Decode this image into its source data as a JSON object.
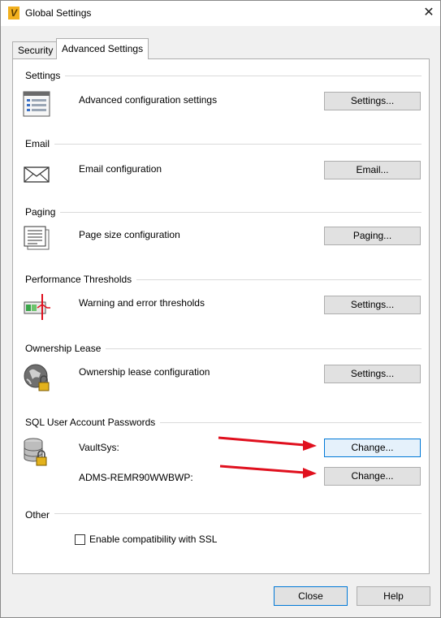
{
  "window": {
    "title": "Global Settings",
    "close_glyph": "✕",
    "app_icon": "vault-logo-icon",
    "app_icon_letter": "V"
  },
  "tabs": [
    {
      "label": "Security",
      "active": false
    },
    {
      "label": "Advanced Settings",
      "active": true
    }
  ],
  "sections": {
    "settings": {
      "title": "Settings",
      "description": "Advanced configuration settings",
      "button": "Settings...",
      "icon": "settings-list-icon"
    },
    "email": {
      "title": "Email",
      "description": "Email configuration",
      "button": "Email...",
      "icon": "envelope-icon"
    },
    "paging": {
      "title": "Paging",
      "description": "Page size configuration",
      "button": "Paging...",
      "icon": "document-pages-icon"
    },
    "performance": {
      "title": "Performance Thresholds",
      "description": "Warning and error thresholds",
      "button": "Settings...",
      "icon": "threshold-meter-icon"
    },
    "ownership": {
      "title": "Ownership Lease",
      "description": "Ownership lease configuration",
      "button": "Settings...",
      "icon": "globe-lock-icon"
    },
    "sql": {
      "title": "SQL User Account Passwords",
      "icon": "database-lock-icon",
      "accounts": [
        {
          "name": "VaultSys:",
          "button": "Change..."
        },
        {
          "name": "ADMS-REMR90WWBWP:",
          "button": "Change..."
        }
      ]
    },
    "other": {
      "title": "Other",
      "checkbox_label": "Enable compatibility with SSL",
      "checked": false
    }
  },
  "footer": {
    "close": "Close",
    "help": "Help"
  },
  "annotations": {
    "arrow_color": "#e0101e"
  }
}
